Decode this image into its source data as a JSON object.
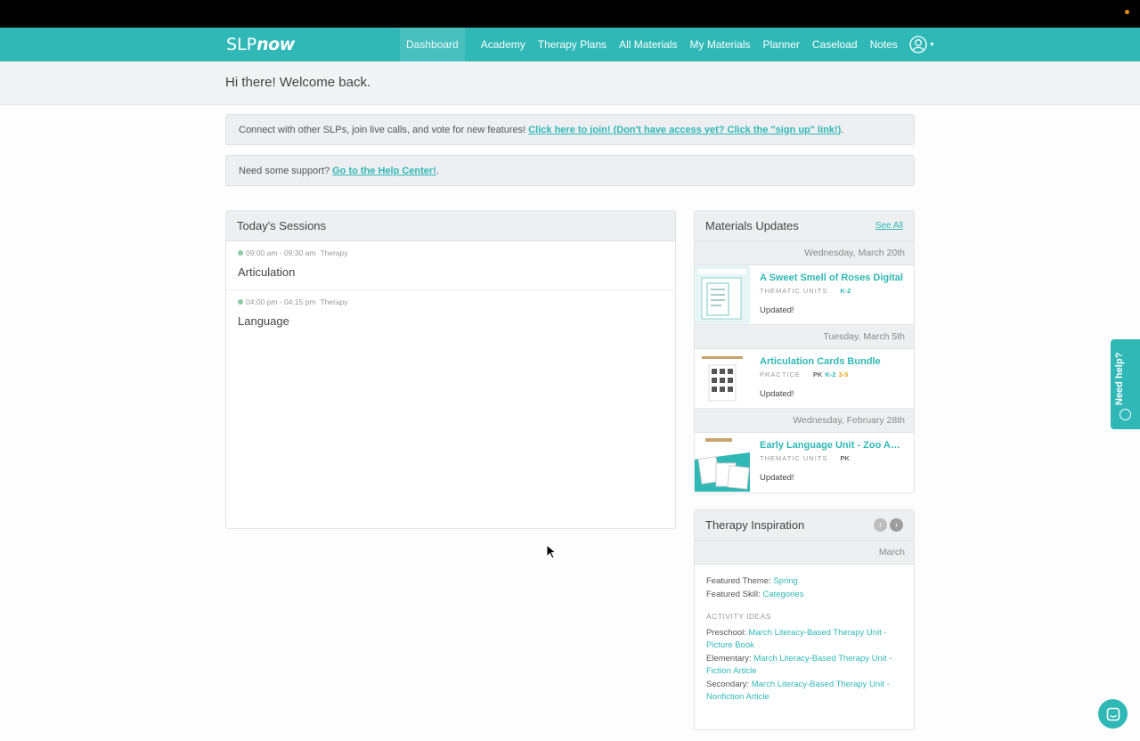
{
  "nav": {
    "logo_slp": "SLP",
    "logo_now": "now",
    "items": [
      {
        "label": "Dashboard",
        "active": true
      },
      {
        "label": "Academy"
      },
      {
        "label": "Therapy Plans"
      },
      {
        "label": "All Materials"
      },
      {
        "label": "My Materials"
      },
      {
        "label": "Planner"
      },
      {
        "label": "Caseload"
      },
      {
        "label": "Notes"
      }
    ],
    "user_icon": "user-avatar-icon"
  },
  "welcome": {
    "heading": "Hi there! Welcome back."
  },
  "notices": {
    "community_text": "Connect with other SLPs, join live calls, and vote for new features!",
    "community_link": "Click here to join! (Don't have access yet? Click the \"sign up\" link!)",
    "community_end": ".",
    "support_text": "Need some support?",
    "support_link": "Go to the Help Center!",
    "support_end": "."
  },
  "sessions": {
    "title": "Today's Sessions",
    "items": [
      {
        "time": "09:00 am - 09:30 am",
        "type": "Therapy",
        "name": "Articulation"
      },
      {
        "time": "04:00 pm - 04:15 pm",
        "type": "Therapy",
        "name": "Language"
      }
    ]
  },
  "materials": {
    "title": "Materials Updates",
    "see_all": "See All",
    "groups": [
      {
        "date": "Wednesday, March 20th",
        "title": "A Sweet Smell of Roses Digital",
        "category": "THEMATIC UNITS",
        "grades": [
          "K-2"
        ],
        "status": "Updated!"
      },
      {
        "date": "Tuesday, March 5th",
        "title": "Articulation Cards Bundle",
        "category": "PRACTICE",
        "grades": [
          "PK",
          "K-2",
          "3-5"
        ],
        "status": "Updated!"
      },
      {
        "date": "Wednesday, February 28th",
        "title": "Early Language Unit - Zoo Animals",
        "category": "THEMATIC UNITS",
        "grades": [
          "PK"
        ],
        "status": "Updated!"
      }
    ]
  },
  "inspiration": {
    "title": "Therapy Inspiration",
    "month": "March",
    "theme_label": "Featured Theme:",
    "theme_value": "Spring",
    "skill_label": "Featured Skill:",
    "skill_value": "Categories",
    "activity_heading": "ACTIVITY IDEAS",
    "activities": [
      {
        "label": "Preschool:",
        "link": "March Literacy-Based Therapy Unit - Picture Book"
      },
      {
        "label": "Elementary:",
        "link": "March Literacy-Based Therapy Unit - Fiction Article"
      },
      {
        "label": "Secondary:",
        "link": "March Literacy-Based Therapy Unit - Nonfiction Article"
      }
    ]
  },
  "help_tab": {
    "label": "Need help?"
  },
  "colors": {
    "accent": "#2fb8b6",
    "topbar": "#000000"
  }
}
